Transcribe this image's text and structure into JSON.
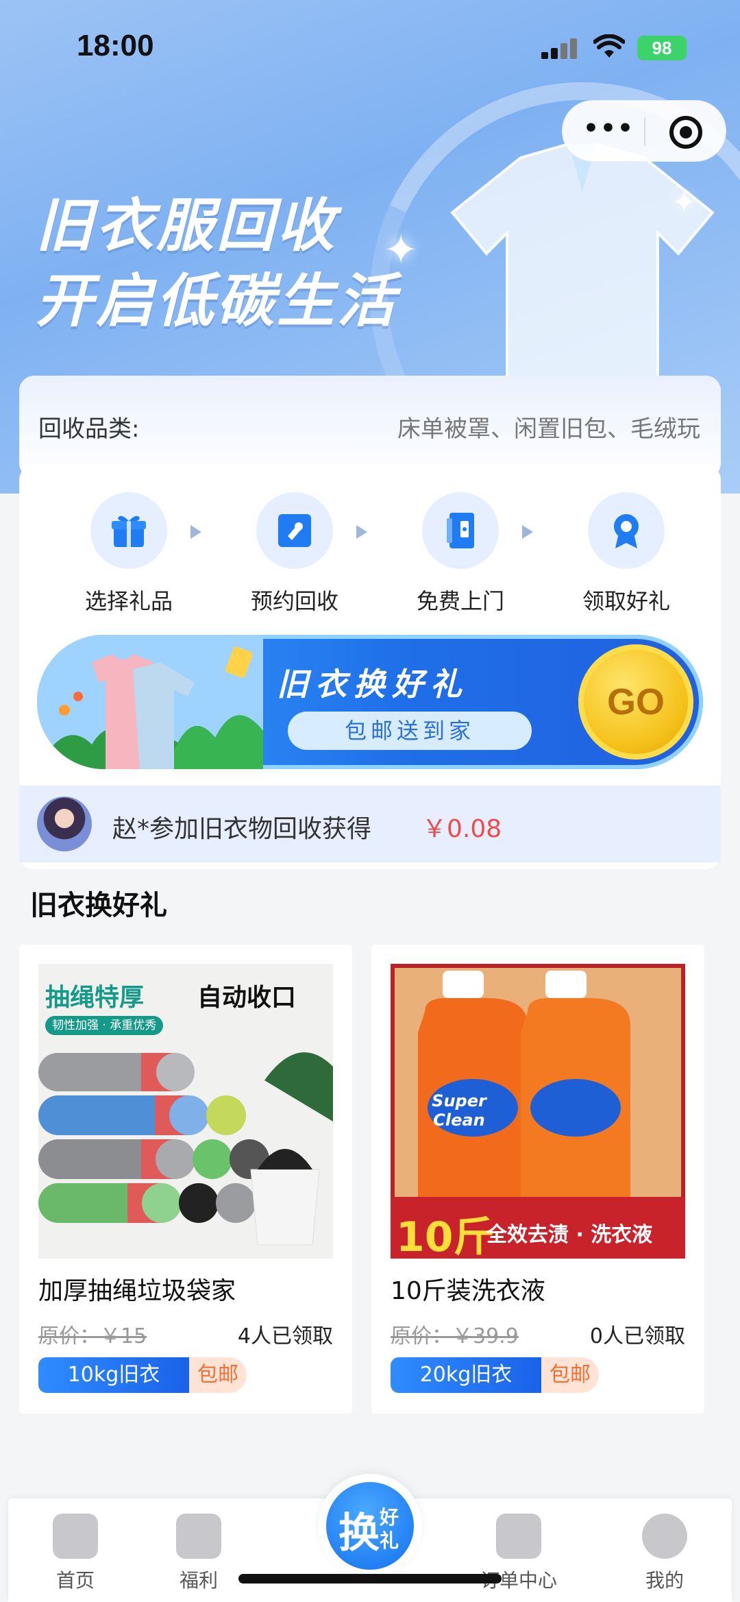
{
  "status_bar": {
    "time": "18:00",
    "battery": "98"
  },
  "hero": {
    "headline_line1": "旧衣服回收",
    "headline_line2": "开启低碳生活"
  },
  "category": {
    "label": "回收品类:",
    "value": "床单被罩、闲置旧包、毛绒玩"
  },
  "steps": [
    {
      "label": "选择礼品",
      "icon": "gift-icon"
    },
    {
      "label": "预约回收",
      "icon": "appointment-icon"
    },
    {
      "label": "免费上门",
      "icon": "door-icon"
    },
    {
      "label": "领取好礼",
      "icon": "badge-icon"
    }
  ],
  "banner": {
    "title": "旧衣换好礼",
    "subtitle": "包邮送到家",
    "go_label": "GO"
  },
  "ticker": {
    "message": "赵*参加旧衣物回收获得",
    "amount": "￥0.08"
  },
  "section_title": "旧衣换好礼",
  "products": [
    {
      "name": "加厚抽绳垃圾袋家",
      "original_price": "原价：￥15",
      "claimed": "4人已领取",
      "tag_main": "10kg旧衣",
      "tag_side": "包邮",
      "image_text_1": "抽绳特厚",
      "image_text_2": "自动收口",
      "image_text_3": "韧性加强 · 承重优秀"
    },
    {
      "name": "10斤装洗衣液",
      "original_price": "原价：￥39.9",
      "claimed": "0人已领取",
      "tag_main": "20kg旧衣",
      "tag_side": "包邮",
      "image_text_1": "Super Clean",
      "image_text_2": "10斤",
      "image_text_3": "全效去渍 · 洗衣液"
    }
  ],
  "tabbar": {
    "items": [
      {
        "label": "首页",
        "icon": "home-icon"
      },
      {
        "label": "福利",
        "icon": "gift-box-icon"
      },
      {
        "label": "订单中心",
        "icon": "clipboard-icon"
      },
      {
        "label": "我的",
        "icon": "user-icon"
      }
    ],
    "center_big": "换",
    "center_small_1": "好",
    "center_small_2": "礼"
  },
  "colors": {
    "primary": "#1f6fe8",
    "accent_red": "#f04a4a",
    "tag_orange": "#f0703a"
  }
}
